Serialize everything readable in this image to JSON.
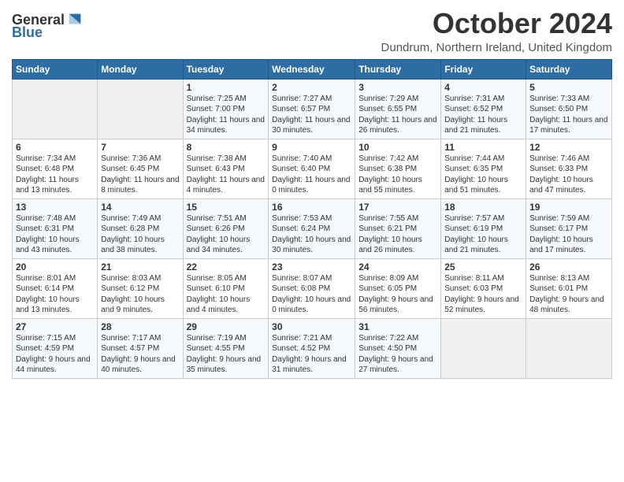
{
  "logo": {
    "general": "General",
    "blue": "Blue"
  },
  "header": {
    "month": "October 2024",
    "location": "Dundrum, Northern Ireland, United Kingdom"
  },
  "days_of_week": [
    "Sunday",
    "Monday",
    "Tuesday",
    "Wednesday",
    "Thursday",
    "Friday",
    "Saturday"
  ],
  "weeks": [
    [
      {
        "day": "",
        "info": ""
      },
      {
        "day": "",
        "info": ""
      },
      {
        "day": "1",
        "info": "Sunrise: 7:25 AM\nSunset: 7:00 PM\nDaylight: 11 hours and 34 minutes."
      },
      {
        "day": "2",
        "info": "Sunrise: 7:27 AM\nSunset: 6:57 PM\nDaylight: 11 hours and 30 minutes."
      },
      {
        "day": "3",
        "info": "Sunrise: 7:29 AM\nSunset: 6:55 PM\nDaylight: 11 hours and 26 minutes."
      },
      {
        "day": "4",
        "info": "Sunrise: 7:31 AM\nSunset: 6:52 PM\nDaylight: 11 hours and 21 minutes."
      },
      {
        "day": "5",
        "info": "Sunrise: 7:33 AM\nSunset: 6:50 PM\nDaylight: 11 hours and 17 minutes."
      }
    ],
    [
      {
        "day": "6",
        "info": "Sunrise: 7:34 AM\nSunset: 6:48 PM\nDaylight: 11 hours and 13 minutes."
      },
      {
        "day": "7",
        "info": "Sunrise: 7:36 AM\nSunset: 6:45 PM\nDaylight: 11 hours and 8 minutes."
      },
      {
        "day": "8",
        "info": "Sunrise: 7:38 AM\nSunset: 6:43 PM\nDaylight: 11 hours and 4 minutes."
      },
      {
        "day": "9",
        "info": "Sunrise: 7:40 AM\nSunset: 6:40 PM\nDaylight: 11 hours and 0 minutes."
      },
      {
        "day": "10",
        "info": "Sunrise: 7:42 AM\nSunset: 6:38 PM\nDaylight: 10 hours and 55 minutes."
      },
      {
        "day": "11",
        "info": "Sunrise: 7:44 AM\nSunset: 6:35 PM\nDaylight: 10 hours and 51 minutes."
      },
      {
        "day": "12",
        "info": "Sunrise: 7:46 AM\nSunset: 6:33 PM\nDaylight: 10 hours and 47 minutes."
      }
    ],
    [
      {
        "day": "13",
        "info": "Sunrise: 7:48 AM\nSunset: 6:31 PM\nDaylight: 10 hours and 43 minutes."
      },
      {
        "day": "14",
        "info": "Sunrise: 7:49 AM\nSunset: 6:28 PM\nDaylight: 10 hours and 38 minutes."
      },
      {
        "day": "15",
        "info": "Sunrise: 7:51 AM\nSunset: 6:26 PM\nDaylight: 10 hours and 34 minutes."
      },
      {
        "day": "16",
        "info": "Sunrise: 7:53 AM\nSunset: 6:24 PM\nDaylight: 10 hours and 30 minutes."
      },
      {
        "day": "17",
        "info": "Sunrise: 7:55 AM\nSunset: 6:21 PM\nDaylight: 10 hours and 26 minutes."
      },
      {
        "day": "18",
        "info": "Sunrise: 7:57 AM\nSunset: 6:19 PM\nDaylight: 10 hours and 21 minutes."
      },
      {
        "day": "19",
        "info": "Sunrise: 7:59 AM\nSunset: 6:17 PM\nDaylight: 10 hours and 17 minutes."
      }
    ],
    [
      {
        "day": "20",
        "info": "Sunrise: 8:01 AM\nSunset: 6:14 PM\nDaylight: 10 hours and 13 minutes."
      },
      {
        "day": "21",
        "info": "Sunrise: 8:03 AM\nSunset: 6:12 PM\nDaylight: 10 hours and 9 minutes."
      },
      {
        "day": "22",
        "info": "Sunrise: 8:05 AM\nSunset: 6:10 PM\nDaylight: 10 hours and 4 minutes."
      },
      {
        "day": "23",
        "info": "Sunrise: 8:07 AM\nSunset: 6:08 PM\nDaylight: 10 hours and 0 minutes."
      },
      {
        "day": "24",
        "info": "Sunrise: 8:09 AM\nSunset: 6:05 PM\nDaylight: 9 hours and 56 minutes."
      },
      {
        "day": "25",
        "info": "Sunrise: 8:11 AM\nSunset: 6:03 PM\nDaylight: 9 hours and 52 minutes."
      },
      {
        "day": "26",
        "info": "Sunrise: 8:13 AM\nSunset: 6:01 PM\nDaylight: 9 hours and 48 minutes."
      }
    ],
    [
      {
        "day": "27",
        "info": "Sunrise: 7:15 AM\nSunset: 4:59 PM\nDaylight: 9 hours and 44 minutes."
      },
      {
        "day": "28",
        "info": "Sunrise: 7:17 AM\nSunset: 4:57 PM\nDaylight: 9 hours and 40 minutes."
      },
      {
        "day": "29",
        "info": "Sunrise: 7:19 AM\nSunset: 4:55 PM\nDaylight: 9 hours and 35 minutes."
      },
      {
        "day": "30",
        "info": "Sunrise: 7:21 AM\nSunset: 4:52 PM\nDaylight: 9 hours and 31 minutes."
      },
      {
        "day": "31",
        "info": "Sunrise: 7:22 AM\nSunset: 4:50 PM\nDaylight: 9 hours and 27 minutes."
      },
      {
        "day": "",
        "info": ""
      },
      {
        "day": "",
        "info": ""
      }
    ]
  ]
}
